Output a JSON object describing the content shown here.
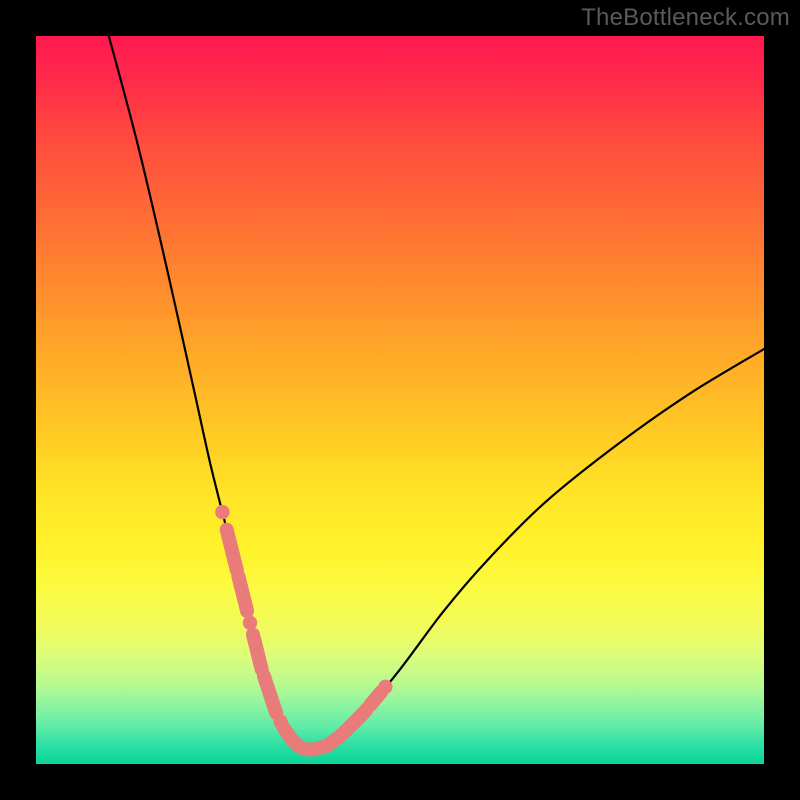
{
  "watermark": "TheBottleneck.com",
  "colors": {
    "bead": "#e97b7b",
    "curve": "#000000",
    "frame": "#000000"
  },
  "chart_data": {
    "type": "line",
    "title": "",
    "xlabel": "",
    "ylabel": "",
    "xlim": [
      0,
      100
    ],
    "ylim": [
      0,
      100
    ],
    "gradient_stops": [
      {
        "pos": 0,
        "color": "#ff1850"
      },
      {
        "pos": 50,
        "color": "#ffd025"
      },
      {
        "pos": 78,
        "color": "#f8fb44"
      },
      {
        "pos": 100,
        "color": "#0cd496"
      }
    ],
    "series": [
      {
        "name": "bottleneck-curve",
        "x": [
          10,
          14,
          18,
          22,
          24,
          26,
          28,
          30,
          31,
          32,
          33,
          34,
          35,
          36,
          37,
          38,
          40,
          42,
          45,
          50,
          56,
          62,
          70,
          80,
          90,
          100
        ],
        "y": [
          100,
          85,
          68,
          50,
          41,
          33,
          25,
          17,
          13,
          10,
          7,
          5,
          3.5,
          2.5,
          2,
          2,
          2.5,
          4,
          7,
          13,
          21,
          28,
          36,
          44,
          51,
          57
        ]
      }
    ],
    "highlight_ranges_x": [
      [
        26,
        36
      ],
      [
        38,
        47
      ]
    ],
    "annotations": []
  }
}
